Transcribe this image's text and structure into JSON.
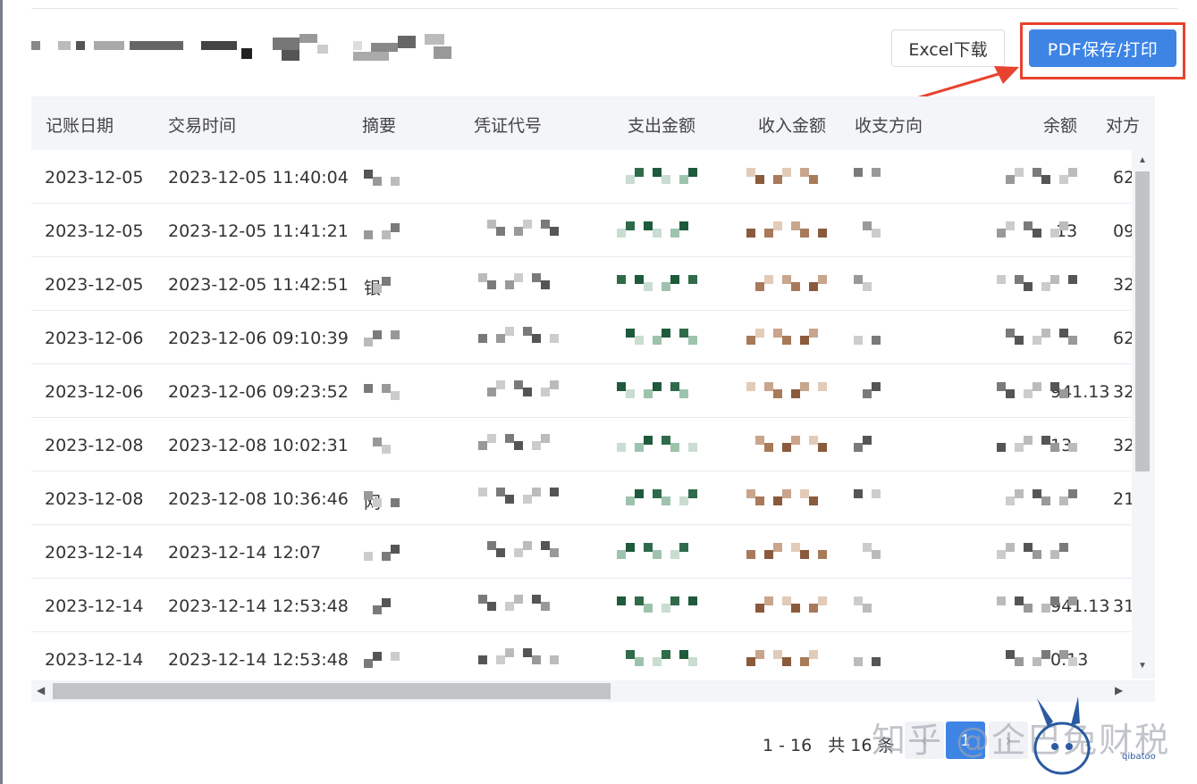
{
  "toolbar": {
    "excel_label": "Excel下载",
    "pdf_label": "PDF保存/打印"
  },
  "table": {
    "columns": [
      "记账日期",
      "交易时间",
      "摘要",
      "凭证代号",
      "支出金额",
      "收入金额",
      "收支方向",
      "余额",
      "对方"
    ],
    "rows": [
      {
        "date": "2023-12-05",
        "time": "2023-12-05 11:40:04",
        "summary": "",
        "balance": "",
        "party": "62"
      },
      {
        "date": "2023-12-05",
        "time": "2023-12-05 11:41:21",
        "summary": "",
        "balance": ".13",
        "party": "09"
      },
      {
        "date": "2023-12-05",
        "time": "2023-12-05 11:42:51",
        "summary": "银",
        "balance": "",
        "party": "32"
      },
      {
        "date": "2023-12-06",
        "time": "2023-12-06 09:10:39",
        "summary": "",
        "balance": "",
        "party": "62"
      },
      {
        "date": "2023-12-06",
        "time": "2023-12-06 09:23:52",
        "summary": "",
        "balance": "941.13",
        "party": "32"
      },
      {
        "date": "2023-12-08",
        "time": "2023-12-08 10:02:31",
        "summary": "",
        "balance": "13",
        "party": "32"
      },
      {
        "date": "2023-12-08",
        "time": "2023-12-08 10:36:46",
        "summary": "网",
        "balance": "",
        "party": "21"
      },
      {
        "date": "2023-12-14",
        "time": "2023-12-14 12:07",
        "summary": "",
        "balance": "",
        "party": ""
      },
      {
        "date": "2023-12-14",
        "time": "2023-12-14 12:53:48",
        "summary": "",
        "balance": "941.13",
        "party": "31"
      },
      {
        "date": "2023-12-14",
        "time": "2023-12-14 12:53:48",
        "summary": "",
        "balance": "0.13",
        "party": ""
      }
    ]
  },
  "pagination": {
    "range_text": "1 - 16",
    "total_text": "共 16 条",
    "current_page": "1",
    "prev": "‹",
    "next": "›"
  },
  "watermark": {
    "text": "知乎 @企巴兔财税",
    "brand": "qibatoo"
  },
  "colors": {
    "primary": "#3d84e5",
    "highlight": "#e8432f",
    "header_bg": "#f3f5f8"
  },
  "icons": {
    "scroll_up": "▲",
    "scroll_down": "▼",
    "scroll_left": "◀",
    "scroll_right": "▶"
  }
}
